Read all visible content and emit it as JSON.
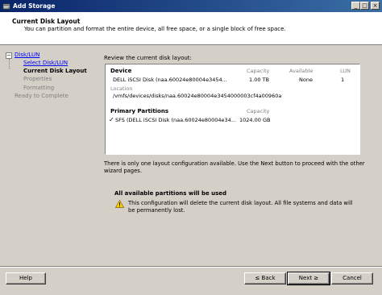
{
  "window": {
    "title": "Add Storage"
  },
  "header": {
    "title": "Current Disk Layout",
    "subtitle": "You can partition and format the entire device, all free space, or a single block of free space."
  },
  "nav": {
    "group": "Disk/LUN",
    "items": [
      {
        "label": "Select Disk/LUN",
        "state": "link"
      },
      {
        "label": "Current Disk Layout",
        "state": "current"
      },
      {
        "label": "Properties",
        "state": "pending"
      },
      {
        "label": "Formatting",
        "state": "pending"
      }
    ],
    "ready": "Ready to Complete"
  },
  "review": {
    "caption": "Review the current disk layout:",
    "device_label": "Device",
    "capacity_label": "Capacity",
    "available_label": "Available",
    "lun_label": "LUN",
    "device_name": "DELL iSCSI Disk (naa.60024e80004e3454...",
    "device_capacity": "1.00 TB",
    "device_available": "None",
    "device_lun": "1",
    "location_label": "Location",
    "location_value": "/vmfs/devices/disks/naa.60024e80004e3454000003cf4a00960a",
    "partitions_label": "Primary Partitions",
    "partitions_capacity_label": "Capacity",
    "partition_name": "SFS (DELL iSCSI Disk (naa.60024e80004e34...",
    "partition_capacity": "1024.00 GB"
  },
  "info": "There is only one layout configuration available. Use the Next button to proceed with the other wizard pages.",
  "warning": {
    "title": "All available partitions will be used",
    "text": "This configuration will delete the current disk layout. All file systems and data will be permanently lost."
  },
  "buttons": {
    "help": "Help",
    "back": "≤ Back",
    "next": "Next ≥",
    "cancel": "Cancel"
  }
}
